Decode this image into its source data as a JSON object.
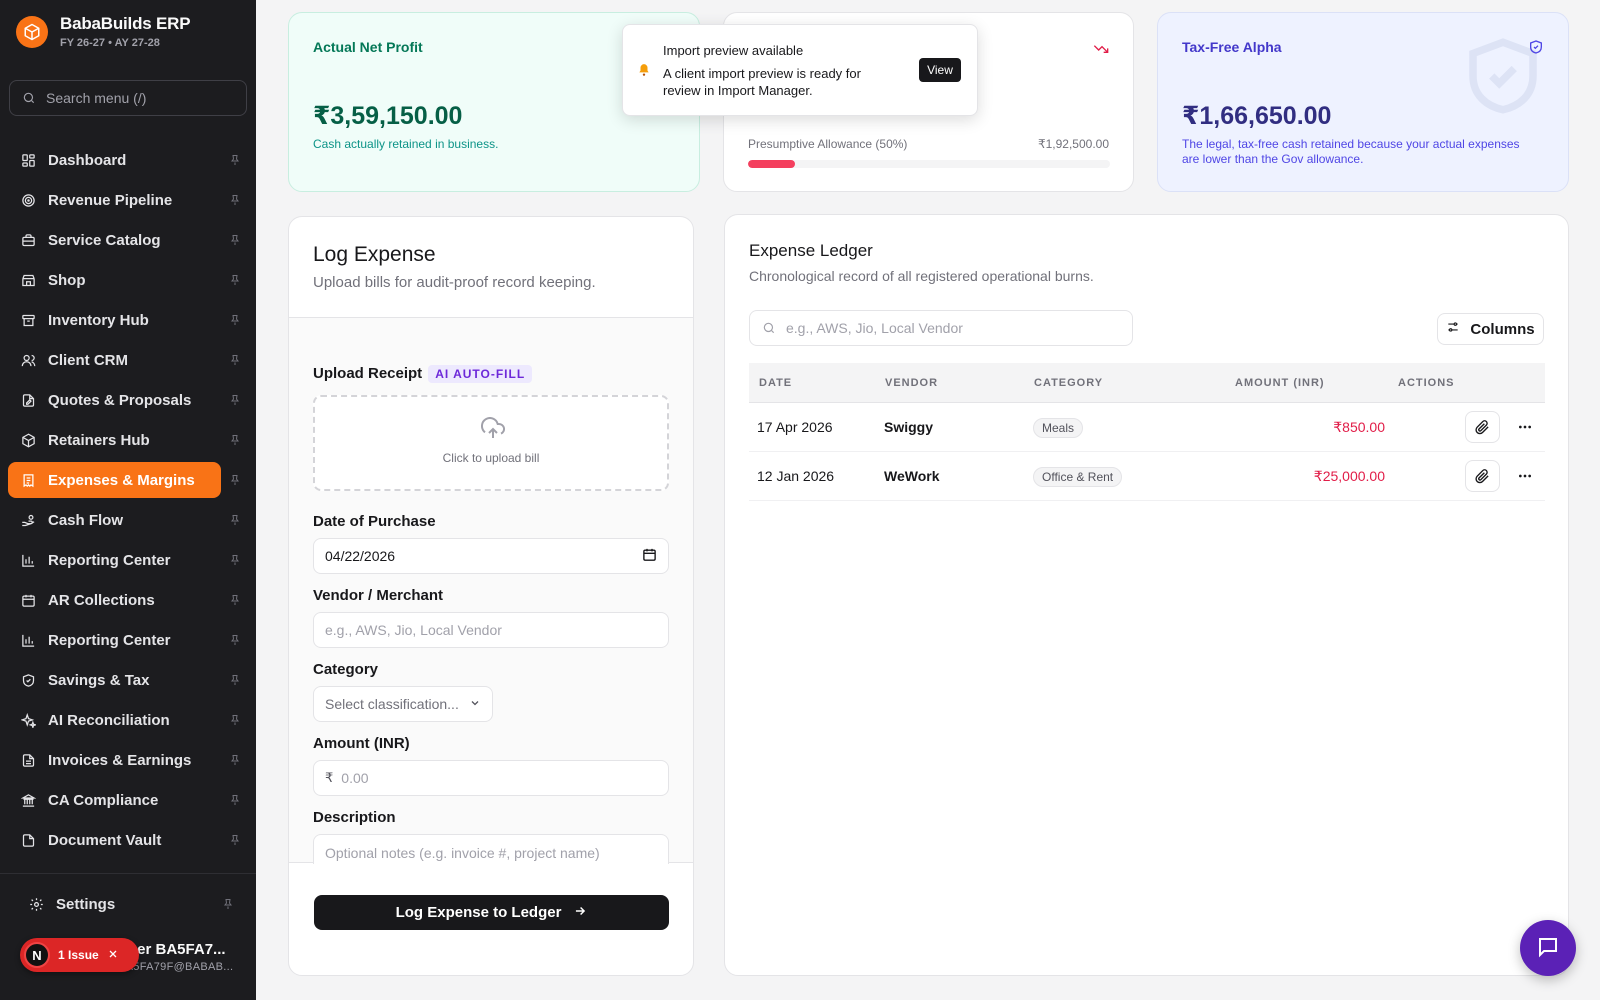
{
  "brand": {
    "title": "BabaBuilds ERP",
    "subtitle": "FY 26-27 • AY 27-28"
  },
  "sidebar": {
    "search_placeholder": "Search menu (/)",
    "items": [
      {
        "label": "Dashboard",
        "icon": "dashboard-icon"
      },
      {
        "label": "Revenue Pipeline",
        "icon": "target-icon"
      },
      {
        "label": "Service Catalog",
        "icon": "briefcase-icon"
      },
      {
        "label": "Shop",
        "icon": "store-icon"
      },
      {
        "label": "Inventory Hub",
        "icon": "archive-icon"
      },
      {
        "label": "Client CRM",
        "icon": "users-icon"
      },
      {
        "label": "Quotes & Proposals",
        "icon": "file-edit-icon"
      },
      {
        "label": "Retainers Hub",
        "icon": "package-icon"
      },
      {
        "label": "Expenses & Margins",
        "icon": "receipt-icon",
        "active": true
      },
      {
        "label": "Cash Flow",
        "icon": "hand-coins-icon"
      },
      {
        "label": "Reporting Center",
        "icon": "bar-chart-icon"
      },
      {
        "label": "AR Collections",
        "icon": "calendar-icon"
      },
      {
        "label": "Reporting Center",
        "icon": "bar-chart-icon"
      },
      {
        "label": "Savings & Tax",
        "icon": "shield-icon"
      },
      {
        "label": "AI Reconciliation",
        "icon": "sparkles-icon"
      },
      {
        "label": "Invoices & Earnings",
        "icon": "file-text-icon"
      },
      {
        "label": "CA Compliance",
        "icon": "landmark-icon"
      },
      {
        "label": "Document Vault",
        "icon": "file-icon"
      }
    ],
    "settings_label": "Settings",
    "user_name": "User BA5FA7...",
    "user_email": "BA5FA79F@BABAB...",
    "issue_avatar": "N",
    "issue_label": "1 Issue"
  },
  "kpis": {
    "net_profit": {
      "title": "Actual Net Profit",
      "value": "₹3,59,150.00",
      "desc": "Cash actually retained in business."
    },
    "allowance": {
      "label": "Presumptive Allowance (50%)",
      "value": "₹1,92,500.00",
      "progress_pct": 13
    },
    "alpha": {
      "title": "Tax-Free Alpha",
      "value": "₹1,66,650.00",
      "desc": "The legal, tax-free cash retained because your actual expenses are lower than the Gov allowance."
    }
  },
  "toast": {
    "title": "Import preview available",
    "message": "A client import preview is ready for review in Import Manager.",
    "action": "View"
  },
  "form": {
    "title": "Log Expense",
    "subtitle": "Upload bills for audit-proof record keeping.",
    "upload_label": "Upload Receipt",
    "ai_badge": "AI AUTO-FILL",
    "upload_text": "Click to upload bill",
    "date_label": "Date of Purchase",
    "date_value": "04/22/2026",
    "vendor_label": "Vendor / Merchant",
    "vendor_placeholder": "e.g., AWS, Jio, Local Vendor",
    "category_label": "Category",
    "category_placeholder": "Select classification...",
    "amount_label": "Amount (INR)",
    "currency_symbol": "₹",
    "amount_placeholder": "0.00",
    "description_label": "Description",
    "description_placeholder": "Optional notes (e.g. invoice #, project name)",
    "submit_label": "Log Expense to Ledger"
  },
  "ledger": {
    "title": "Expense Ledger",
    "subtitle": "Chronological record of all registered operational burns.",
    "search_placeholder": "e.g., AWS, Jio, Local Vendor",
    "columns_label": "Columns",
    "headers": {
      "date": "DATE",
      "vendor": "VENDOR",
      "category": "CATEGORY",
      "amount": "AMOUNT (INR)",
      "actions": "ACTIONS"
    },
    "rows": [
      {
        "date": "17 Apr 2026",
        "vendor": "Swiggy",
        "category": "Meals",
        "amount": "₹850.00"
      },
      {
        "date": "12 Jan 2026",
        "vendor": "WeWork",
        "category": "Office & Rent",
        "amount": "₹25,000.00"
      }
    ]
  },
  "colors": {
    "accent": "#f97316",
    "profit": "#047857",
    "alpha": "#4338ca",
    "negative": "#e11d48",
    "chat": "#5b21b6"
  }
}
